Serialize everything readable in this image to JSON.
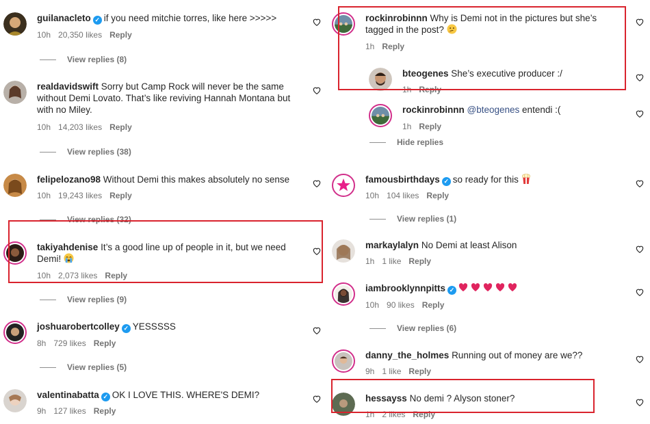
{
  "left": [
    {
      "user": "guilanacleto",
      "verified": true,
      "text": "if you need mitchie torres, like here >>>>>",
      "time": "10h",
      "likes": "20,350 likes",
      "reply": "Reply",
      "view": "View replies (8)"
    },
    {
      "user": "realdavidswift",
      "verified": false,
      "text": "Sorry but Camp Rock will never be the same",
      "text2": "without Demi Lovato. That’s like reviving Hannah Montana but",
      "text3": "with no Miley.",
      "time": "10h",
      "likes": "14,203 likes",
      "reply": "Reply",
      "view": "View replies (38)"
    },
    {
      "user": "felipelozano98",
      "verified": false,
      "text": "Without Demi this makes absolutely no sense",
      "time": "10h",
      "likes": "19,243 likes",
      "reply": "Reply",
      "view": "View replies (32)"
    },
    {
      "user": "takiyahdenise",
      "verified": false,
      "text": "It’s a good line up of people in it, but we need",
      "text2": "Demi!",
      "time": "10h",
      "likes": "2,073 likes",
      "reply": "Reply",
      "view": "View replies (9)"
    },
    {
      "user": "joshuarobertcolley",
      "verified": true,
      "text": "YESSSSS",
      "time": "8h",
      "likes": "729 likes",
      "reply": "Reply",
      "view": "View replies (5)"
    },
    {
      "user": "valentinabatta",
      "verified": true,
      "text": "OK I LOVE THIS. WHERE'S DEMI?",
      "time": "9h",
      "likes": "127 likes",
      "reply": "Reply"
    }
  ],
  "right": [
    {
      "user": "rockinrobinnn",
      "verified": false,
      "text": "Why is Demi not in the pictures but she’s",
      "text2": "tagged in the post?",
      "time": "1h",
      "reply": "Reply"
    },
    {
      "user": "bteogenes",
      "verified": false,
      "text": "She’s executive producer :/",
      "time": "1h",
      "reply": "Reply"
    },
    {
      "user": "rockinrobinnn",
      "verified": false,
      "mention": "@bteogenes",
      "text": "entendi :(",
      "time": "1h",
      "reply": "Reply",
      "hide": "Hide replies"
    },
    {
      "user": "famousbirthdays",
      "verified": true,
      "text": "so ready for this",
      "time": "10h",
      "likes": "104 likes",
      "reply": "Reply",
      "view": "View replies (1)"
    },
    {
      "user": "markaylalyn",
      "verified": false,
      "text": "No Demi at least Alison",
      "time": "1h",
      "likes": "1 like",
      "reply": "Reply"
    },
    {
      "user": "iambrooklynnpitts",
      "verified": true,
      "text": "",
      "time": "10h",
      "likes": "90 likes",
      "reply": "Reply",
      "view": "View replies (6)"
    },
    {
      "user": "danny_the_holmes",
      "verified": false,
      "text": "Running out of money are we??",
      "time": "9h",
      "likes": "1 like",
      "reply": "Reply"
    },
    {
      "user": "hessayss",
      "verified": false,
      "text": "No demi ? Alyson stoner?",
      "time": "1h",
      "likes": "2 likes",
      "reply": "Reply"
    }
  ],
  "icons": {
    "heart": "heart-outline-icon",
    "verified": "verified-badge-icon"
  },
  "colors": {
    "highlight": "#d9232d",
    "verified": "#1d9bf0",
    "mention": "#385185",
    "story_ring": "#d12e8a"
  }
}
